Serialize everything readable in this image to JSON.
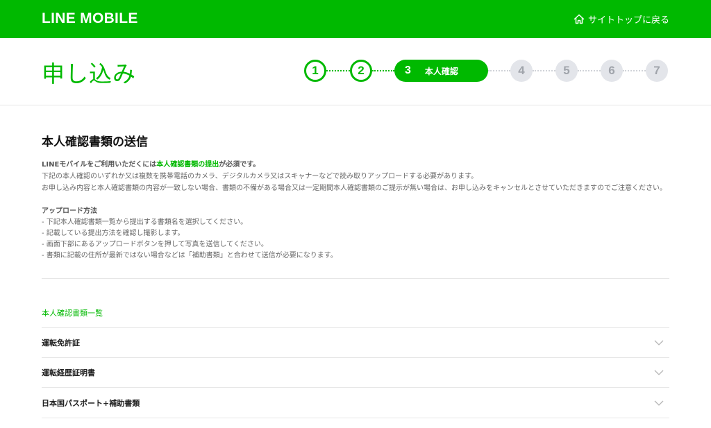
{
  "header": {
    "logo": "LINE MOBILE",
    "home_link": "サイトトップに戻る",
    "home_icon": "home-icon",
    "brand_color": "#00b900"
  },
  "page": {
    "title": "申し込み"
  },
  "stepper": {
    "current_step": 3,
    "steps": [
      {
        "number": "1",
        "state": "done"
      },
      {
        "number": "2",
        "state": "done"
      },
      {
        "number": "3",
        "state": "current",
        "label": "本人確認"
      },
      {
        "number": "4",
        "state": "todo"
      },
      {
        "number": "5",
        "state": "todo"
      },
      {
        "number": "6",
        "state": "todo"
      },
      {
        "number": "7",
        "state": "todo"
      }
    ]
  },
  "content": {
    "section_title": "本人確認書類の送信",
    "lead_prefix": "LINEモバイルをご利用いただくには",
    "lead_highlight": "本人確認書類の提出",
    "lead_suffix": "が必須です。",
    "line1": "下記の本人確認のいずれか又は複数を携帯電話のカメラ、デジタルカメラ又はスキャナーなどで読み取りアップロードする必要があります。",
    "line2": "お申し込み内容と本人確認書類の内容が一致しない場合、書類の不備がある場合又は一定期間本人確認書類のご提示が無い場合は、お申し込みをキャンセルとさせていただきますのでご注意ください。",
    "upload_heading": "アップロード方法",
    "upload_steps": [
      "- 下記本人確認書類一覧から提出する書類名を選択してください。",
      "- 記載している提出方法を確認し撮影します。",
      "- 画面下部にあるアップロードボタンを押して写真を送信してください。",
      "- 書類に記載の住所が最新ではない場合などは「補助書類」と合わせて送信が必要になります。"
    ],
    "doc_list_title": "本人確認書類一覧",
    "doc_items": [
      {
        "label": "運転免許証",
        "icon": "chevron-down-icon"
      },
      {
        "label": "運転経歴証明書",
        "icon": "chevron-down-icon"
      },
      {
        "label": "日本国パスポート+補助書類",
        "icon": "chevron-down-icon"
      }
    ]
  }
}
